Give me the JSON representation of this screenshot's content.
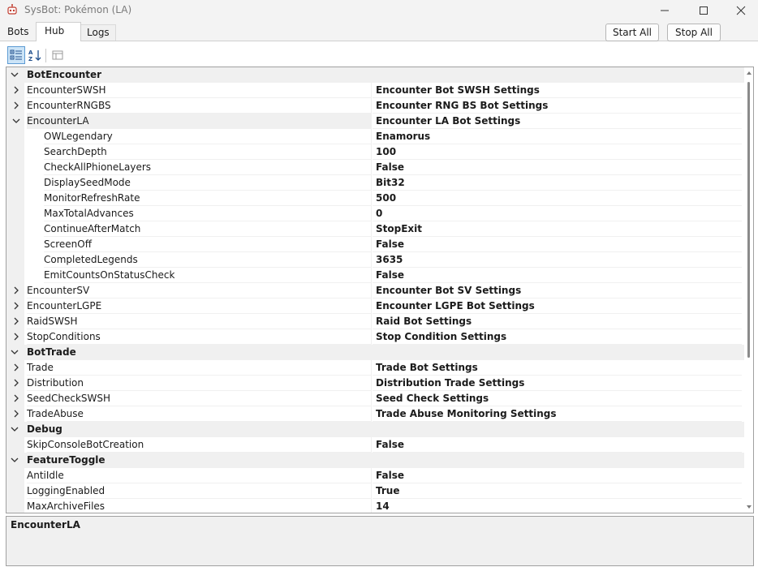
{
  "window": {
    "title": "SysBot: Pokémon (LA)"
  },
  "tabs": [
    {
      "label": "Bots"
    },
    {
      "label": "Hub"
    },
    {
      "label": "Logs"
    }
  ],
  "actions": {
    "start_all": "Start All",
    "stop_all": "Stop All"
  },
  "toolbar": {
    "categorized_icon": "categorized-icon",
    "alphabetical_icon": "alphabetical-sort-icon",
    "property_pages_icon": "property-pages-icon"
  },
  "grid": {
    "rows": [
      {
        "name": "BotEncounter",
        "value": ""
      },
      {
        "name": "EncounterSWSH",
        "value": "Encounter Bot SWSH Settings"
      },
      {
        "name": "EncounterRNGBS",
        "value": "Encounter RNG BS Bot Settings"
      },
      {
        "name": "EncounterLA",
        "value": "Encounter LA Bot Settings"
      },
      {
        "name": "OWLegendary",
        "value": "Enamorus"
      },
      {
        "name": "SearchDepth",
        "value": "100"
      },
      {
        "name": "CheckAllPhioneLayers",
        "value": "False"
      },
      {
        "name": "DisplaySeedMode",
        "value": "Bit32"
      },
      {
        "name": "MonitorRefreshRate",
        "value": "500"
      },
      {
        "name": "MaxTotalAdvances",
        "value": "0"
      },
      {
        "name": "ContinueAfterMatch",
        "value": "StopExit"
      },
      {
        "name": "ScreenOff",
        "value": "False"
      },
      {
        "name": "CompletedLegends",
        "value": "3635"
      },
      {
        "name": "EmitCountsOnStatusCheck",
        "value": "False"
      },
      {
        "name": "EncounterSV",
        "value": "Encounter Bot SV Settings"
      },
      {
        "name": "EncounterLGPE",
        "value": "Encounter LGPE Bot Settings"
      },
      {
        "name": "RaidSWSH",
        "value": "Raid Bot Settings"
      },
      {
        "name": "StopConditions",
        "value": "Stop Condition Settings"
      },
      {
        "name": "BotTrade",
        "value": ""
      },
      {
        "name": "Trade",
        "value": "Trade Bot Settings"
      },
      {
        "name": "Distribution",
        "value": "Distribution Trade Settings"
      },
      {
        "name": "SeedCheckSWSH",
        "value": "Seed Check Settings"
      },
      {
        "name": "TradeAbuse",
        "value": "Trade Abuse Monitoring Settings"
      },
      {
        "name": "Debug",
        "value": ""
      },
      {
        "name": "SkipConsoleBotCreation",
        "value": "False"
      },
      {
        "name": "FeatureToggle",
        "value": ""
      },
      {
        "name": "AntiIdle",
        "value": "False"
      },
      {
        "name": "LoggingEnabled",
        "value": "True"
      },
      {
        "name": "MaxArchiveFiles",
        "value": "14"
      }
    ]
  },
  "help": {
    "title": "EncounterLA",
    "description": ""
  }
}
